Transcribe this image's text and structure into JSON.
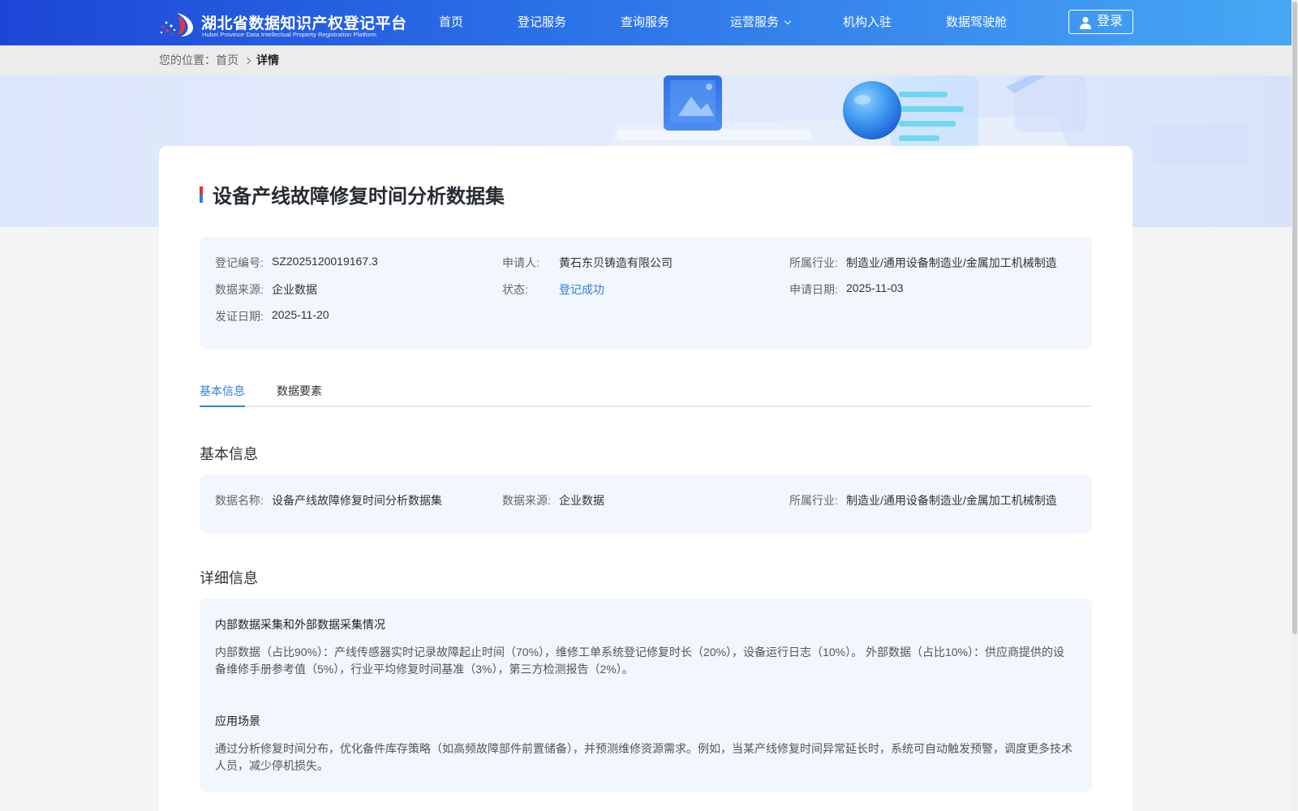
{
  "header": {
    "logo_cn": "湖北省数据知识产权登记平台",
    "logo_en": "Hubei Province Data Intellectual Property Registration Platform",
    "nav": [
      {
        "label": "首页"
      },
      {
        "label": "登记服务"
      },
      {
        "label": "查询服务"
      },
      {
        "label": "运营服务",
        "dropdown": true
      },
      {
        "label": "机构入驻"
      },
      {
        "label": "数据驾驶舱"
      }
    ],
    "login_label": "登录"
  },
  "breadcrumb": {
    "prefix": "您的位置：",
    "home": "首页",
    "current": "详情"
  },
  "detail": {
    "title": "设备产线故障修复时间分析数据集",
    "info": [
      {
        "key": "登记编号:",
        "value": "SZ2025120019167.3"
      },
      {
        "key": "申请人:",
        "value": "黄石东贝铸造有限公司"
      },
      {
        "key": "所属行业:",
        "value": "制造业/通用设备制造业/金属加工机械制造"
      },
      {
        "key": "数据来源:",
        "value": "企业数据"
      },
      {
        "key": "状态:",
        "value": "登记成功"
      },
      {
        "key": "申请日期:",
        "value": "2025-11-03"
      },
      {
        "key": "发证日期:",
        "value": "2025-11-20"
      }
    ],
    "tabs": [
      {
        "label": "基本信息",
        "active": true
      },
      {
        "label": "数据要素",
        "active": false
      }
    ],
    "basic_title": "基本信息",
    "basic": [
      {
        "key": "数据名称:",
        "value": "设备产线故障修复时间分析数据集"
      },
      {
        "key": "数据来源:",
        "value": "企业数据"
      },
      {
        "key": "所属行业:",
        "value": "制造业/通用设备制造业/金属加工机械制造"
      }
    ],
    "detail_title": "详细信息",
    "sections": [
      {
        "heading": "内部数据采集和外部数据采集情况",
        "text": "内部数据（占比90%）：产线传感器实时记录故障起止时间（70%），维修工单系统登记修复时长（20%），设备运行日志（10%）。 外部数据（占比10%）：供应商提供的设备维修手册参考值（5%），行业平均修复时间基准（3%），第三方检测报告（2%）。"
      },
      {
        "heading": "应用场景",
        "text": "通过分析修复时间分布，优化备件库存策略（如高频故障部件前置储备），并预测维修资源需求。例如，当某产线修复时间异常延长时，系统可自动触发预警，调度更多技术人员，减少停机损失。"
      }
    ]
  },
  "colors": {
    "header_start": "#1d46d6",
    "header_end": "#46a8f4",
    "accent_blue": "#2f7fe0",
    "panel_bg": "#f2f6fd",
    "title_accent_red": "#e4322b",
    "title_accent_blue": "#2f7fe0"
  }
}
